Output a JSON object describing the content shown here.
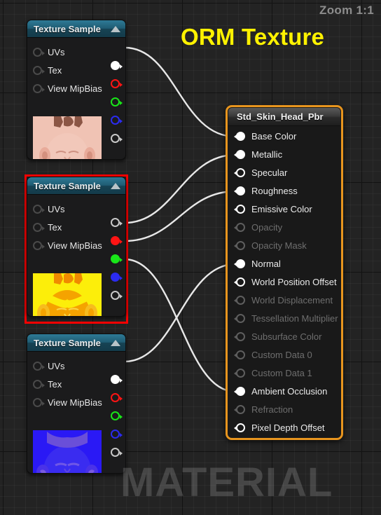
{
  "viewport": {
    "zoom_label": "Zoom 1:1",
    "watermark": "MATERIAL",
    "annotation_title": "ORM Texture",
    "annotation_color": "#fff200",
    "selection_color": "#ff0000",
    "material_border_color": "#e8951e"
  },
  "nodes": {
    "texture_basecolor": {
      "title": "Texture Sample",
      "selected": false,
      "thumbnail_name": "skin-head-diffuse-thumbnail",
      "inputs": [
        {
          "label": "UVs"
        },
        {
          "label": "Tex"
        },
        {
          "label": "View MipBias"
        }
      ],
      "outputs": [
        {
          "name": "RGB",
          "color": "#ffffff",
          "connected": true
        },
        {
          "name": "R",
          "color": "#ff1414",
          "connected": false
        },
        {
          "name": "G",
          "color": "#19e619",
          "connected": false
        },
        {
          "name": "B",
          "color": "#2b2bf0",
          "connected": false
        },
        {
          "name": "A",
          "color": "#c8c8c8",
          "connected": false
        }
      ]
    },
    "texture_orm": {
      "title": "Texture Sample",
      "selected": true,
      "thumbnail_name": "orm-packed-thumbnail",
      "inputs": [
        {
          "label": "UVs"
        },
        {
          "label": "Tex"
        },
        {
          "label": "View MipBias"
        }
      ],
      "outputs": [
        {
          "name": "RGB",
          "color": "#c8c8c8",
          "connected": false
        },
        {
          "name": "R",
          "color": "#ff1414",
          "connected": true
        },
        {
          "name": "G",
          "color": "#19e619",
          "connected": true
        },
        {
          "name": "B",
          "color": "#2b2bf0",
          "connected": true
        },
        {
          "name": "A",
          "color": "#c8c8c8",
          "connected": false
        }
      ]
    },
    "texture_normal": {
      "title": "Texture Sample",
      "selected": false,
      "thumbnail_name": "normal-map-thumbnail",
      "inputs": [
        {
          "label": "UVs"
        },
        {
          "label": "Tex"
        },
        {
          "label": "View MipBias"
        }
      ],
      "outputs": [
        {
          "name": "RGB",
          "color": "#ffffff",
          "connected": true
        },
        {
          "name": "R",
          "color": "#ff1414",
          "connected": false
        },
        {
          "name": "G",
          "color": "#19e619",
          "connected": false
        },
        {
          "name": "B",
          "color": "#2b2bf0",
          "connected": false
        },
        {
          "name": "A",
          "color": "#c8c8c8",
          "connected": false
        }
      ]
    },
    "material": {
      "title": "Std_Skin_Head_Pbr",
      "inputs": [
        {
          "label": "Base Color",
          "enabled": true,
          "connected": true
        },
        {
          "label": "Metallic",
          "enabled": true,
          "connected": true
        },
        {
          "label": "Specular",
          "enabled": true,
          "connected": false
        },
        {
          "label": "Roughness",
          "enabled": true,
          "connected": true
        },
        {
          "label": "Emissive Color",
          "enabled": true,
          "connected": false
        },
        {
          "label": "Opacity",
          "enabled": false,
          "connected": false
        },
        {
          "label": "Opacity Mask",
          "enabled": false,
          "connected": false
        },
        {
          "label": "Normal",
          "enabled": true,
          "connected": true
        },
        {
          "label": "World Position Offset",
          "enabled": true,
          "connected": false
        },
        {
          "label": "World Displacement",
          "enabled": false,
          "connected": false
        },
        {
          "label": "Tessellation Multiplier",
          "enabled": false,
          "connected": false
        },
        {
          "label": "Subsurface Color",
          "enabled": false,
          "connected": false
        },
        {
          "label": "Custom Data 0",
          "enabled": false,
          "connected": false
        },
        {
          "label": "Custom Data 1",
          "enabled": false,
          "connected": false
        },
        {
          "label": "Ambient Occlusion",
          "enabled": true,
          "connected": true
        },
        {
          "label": "Refraction",
          "enabled": false,
          "connected": false
        },
        {
          "label": "Pixel Depth Offset",
          "enabled": true,
          "connected": false
        }
      ]
    }
  },
  "connections": [
    {
      "from": "texture_basecolor.RGB",
      "to": "material.Base Color"
    },
    {
      "from": "texture_orm.R",
      "to": "material.Metallic"
    },
    {
      "from": "texture_orm.G",
      "to": "material.Roughness"
    },
    {
      "from": "texture_orm.B",
      "to": "material.Ambient Occlusion"
    },
    {
      "from": "texture_normal.RGB",
      "to": "material.Normal"
    }
  ]
}
